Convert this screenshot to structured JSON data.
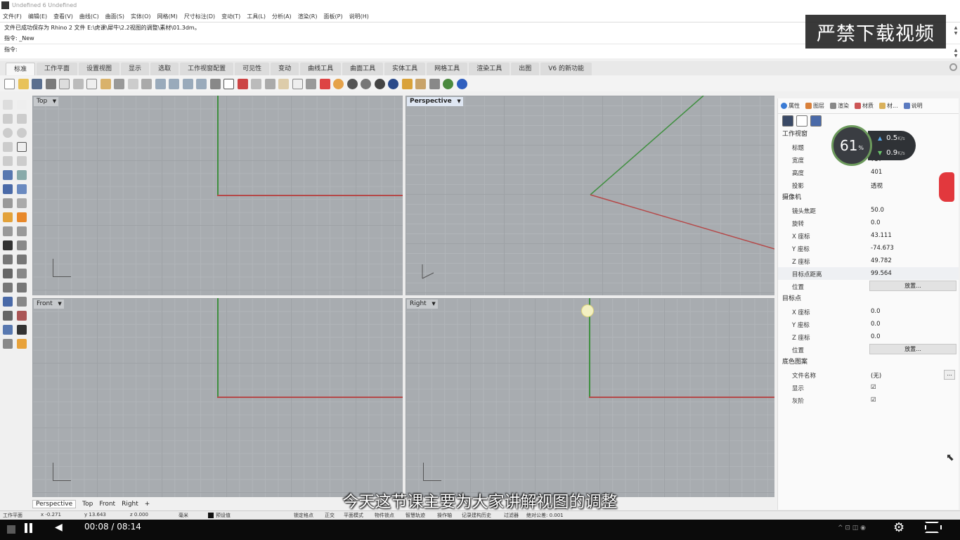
{
  "window": {
    "title": "Undefined 6 Undefined"
  },
  "menu": [
    "文件(F)",
    "编辑(E)",
    "查看(V)",
    "曲线(C)",
    "曲面(S)",
    "实体(O)",
    "网格(M)",
    "尺寸标注(D)",
    "变动(T)",
    "工具(L)",
    "分析(A)",
    "渲染(R)",
    "面板(P)",
    "说明(H)"
  ],
  "command": {
    "history": "文件已成功保存为 Rhino 2 文件 E:\\虎课\\犀牛\\2.2视图的调整\\素材\\01.3dm。",
    "last": "指令: _New",
    "prompt": "指令:"
  },
  "watermark": "严禁下载视频",
  "tabs": [
    "标准",
    "工作平面",
    "设置视图",
    "显示",
    "选取",
    "工作视窗配置",
    "可见性",
    "变动",
    "曲线工具",
    "曲面工具",
    "实体工具",
    "网格工具",
    "渲染工具",
    "出图",
    "V6 的新功能"
  ],
  "viewports": {
    "top": "Top",
    "perspective": "Perspective",
    "front": "Front",
    "right": "Right"
  },
  "viewport_tabs": [
    "Perspective",
    "Top",
    "Front",
    "Right",
    "+"
  ],
  "status": {
    "plane": "工作平面",
    "x": "x -0.271",
    "y": "y 13.643",
    "z": "z 0.000",
    "unit": "毫米",
    "layer": "预设值",
    "snap": "锁定格点",
    "ortho": "正交",
    "planar": "平面模式",
    "osnap": "物件锁点",
    "smarttrack": "智慧轨迹",
    "gumball": "操作轴",
    "history": "记录建构历史",
    "filter": "过滤器",
    "tolerance": "绝对公差: 0.001"
  },
  "panel": {
    "tabs": [
      "属性",
      "图层",
      "渲染",
      "材质",
      "材...",
      "说明"
    ],
    "sections": {
      "viewport": "工作视窗",
      "camera": "摄像机",
      "target": "目标点",
      "wallpaper": "底色图案"
    },
    "viewport_rows": [
      {
        "k": "标题",
        "v": ""
      },
      {
        "k": "宽度",
        "v": "737"
      },
      {
        "k": "高度",
        "v": "401"
      },
      {
        "k": "投影",
        "v": "透视"
      }
    ],
    "camera_rows": [
      {
        "k": "镜头焦距",
        "v": "50.0"
      },
      {
        "k": "旋转",
        "v": "0.0"
      },
      {
        "k": "X 座标",
        "v": "43.111"
      },
      {
        "k": "Y 座标",
        "v": "-74.673"
      },
      {
        "k": "Z 座标",
        "v": "49.782"
      },
      {
        "k": "目标点距离",
        "v": "99.564"
      }
    ],
    "position_label": "位置",
    "place_button": "放置...",
    "target_rows": [
      {
        "k": "X 座标",
        "v": "0.0"
      },
      {
        "k": "Y 座标",
        "v": "0.0"
      },
      {
        "k": "Z 座标",
        "v": "0.0"
      }
    ],
    "wallpaper_rows": {
      "filename_k": "文件名称",
      "filename_v": "(无)",
      "show_k": "显示",
      "show_v": "☑",
      "gray_k": "灰阶",
      "gray_v": "☑"
    },
    "ellipsis": "..."
  },
  "net_widget": {
    "percent": "61",
    "percent_unit": "%",
    "up": "0.5",
    "down": "0.9",
    "unit": "K/s"
  },
  "subtitle": "今天这节课主要为大家讲解视图的调整",
  "player": {
    "time": "00:08 / 08:14"
  },
  "colors": {
    "viewport_bg": "#a8acb0",
    "axis_x": "#b54848",
    "axis_y": "#3f8f3f"
  }
}
